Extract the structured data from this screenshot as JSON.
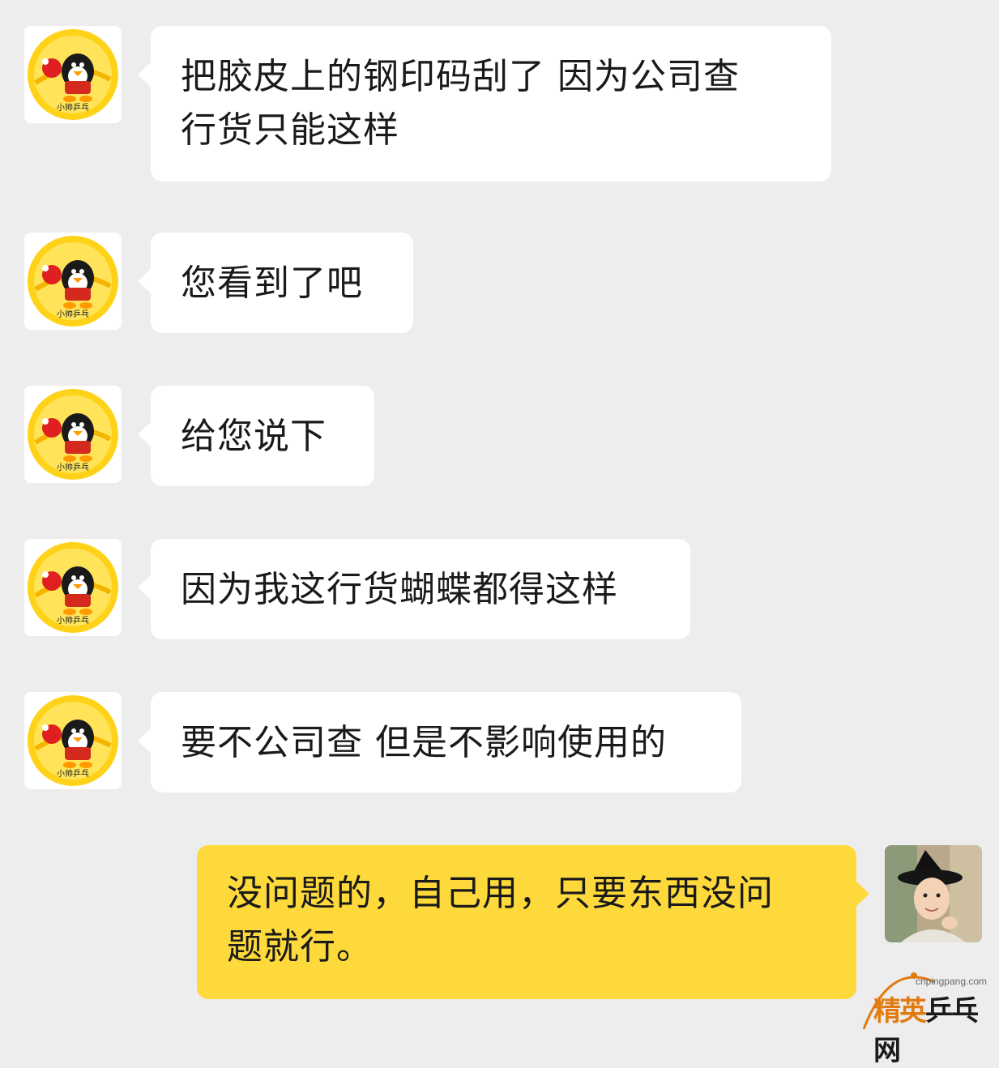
{
  "colors": {
    "background": "#ededed",
    "incoming_bubble": "#ffffff",
    "outgoing_bubble": "#fdd93b",
    "avatar_badge_yellow": "#ffd21a"
  },
  "contact": {
    "avatar_icon": "qq-penguin-pingpong-icon",
    "avatar_caption": "小帅乒乓"
  },
  "self": {
    "avatar_icon": "child-in-black-hat-photo"
  },
  "messages": [
    {
      "sender": "contact",
      "lines": [
        "把胶皮上的钢印码刮了 因为公司查",
        "行货只能这样"
      ]
    },
    {
      "sender": "contact",
      "lines": [
        "您看到了吧"
      ]
    },
    {
      "sender": "contact",
      "lines": [
        "给您说下"
      ]
    },
    {
      "sender": "contact",
      "lines": [
        "因为我这行货蝴蝶都得这样"
      ]
    },
    {
      "sender": "contact",
      "lines": [
        "要不公司查 但是不影响使用的"
      ]
    },
    {
      "sender": "self",
      "lines": [
        "没问题的，自己用，只要东西没问",
        "题就行。"
      ]
    }
  ],
  "watermark": {
    "url": "cnpingpang.com",
    "brand_part1": "精英",
    "brand_part2": "乒乓网"
  }
}
